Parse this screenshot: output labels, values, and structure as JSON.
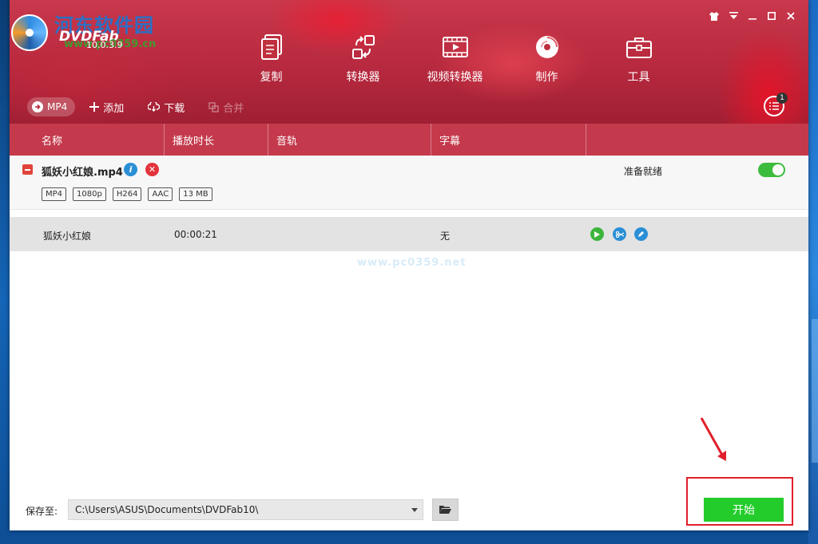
{
  "app": {
    "brand": "DVDFab",
    "version": "10.0.3.9",
    "watermark_top": "河东软件园",
    "watermark_url": "www.pc0359.cn",
    "watermark_center": "www.pc0359.net"
  },
  "window_controls": [
    "skin-icon",
    "menu-icon",
    "minimize-icon",
    "maximize-icon",
    "close-icon"
  ],
  "nav": [
    {
      "label": "复制",
      "icon": "copy-icon"
    },
    {
      "label": "转换器",
      "icon": "ripper-icon"
    },
    {
      "label": "视频转换器",
      "icon": "video-converter-icon"
    },
    {
      "label": "制作",
      "icon": "creator-icon"
    },
    {
      "label": "工具",
      "icon": "toolbox-icon"
    }
  ],
  "toolbar": {
    "profile": "MP4",
    "add": "添加",
    "download": "下载",
    "merge": "合并",
    "queue_count": "1"
  },
  "columns": [
    "名称",
    "播放时长",
    "音轨",
    "字幕"
  ],
  "file": {
    "name": "狐妖小红娘.mp4",
    "tags": [
      "MP4",
      "1080p",
      "H264",
      "AAC",
      "13 MB"
    ],
    "status": "准备就绪",
    "enabled": true
  },
  "title_row": {
    "name": "狐妖小红娘",
    "duration": "00:00:21",
    "audio": "",
    "subtitle": "无"
  },
  "bottom": {
    "save_label": "保存至:",
    "path": "C:\\Users\\ASUS\\Documents\\DVDFab10\\",
    "start": "开始"
  },
  "colors": {
    "header": "#b7293e",
    "column_header": "#c43a4c",
    "start_button": "#23cc2b",
    "annotation": "#e01f2a"
  }
}
